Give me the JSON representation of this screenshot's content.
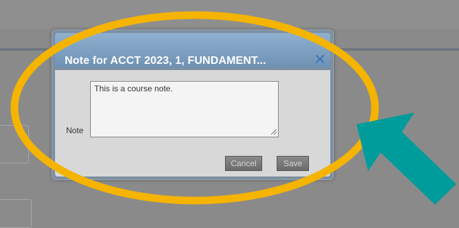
{
  "dialog": {
    "title": "Note for ACCT 2023, 1, FUNDAMENT...",
    "close_icon": "close-icon",
    "note_label": "Note",
    "note_value": "This is a course note.",
    "cancel_label": "Cancel",
    "save_label": "Save"
  },
  "colors": {
    "annotation_ellipse": "#f5b400",
    "annotation_arrow": "#009b9b",
    "titlebar": "#7d9dbd"
  }
}
